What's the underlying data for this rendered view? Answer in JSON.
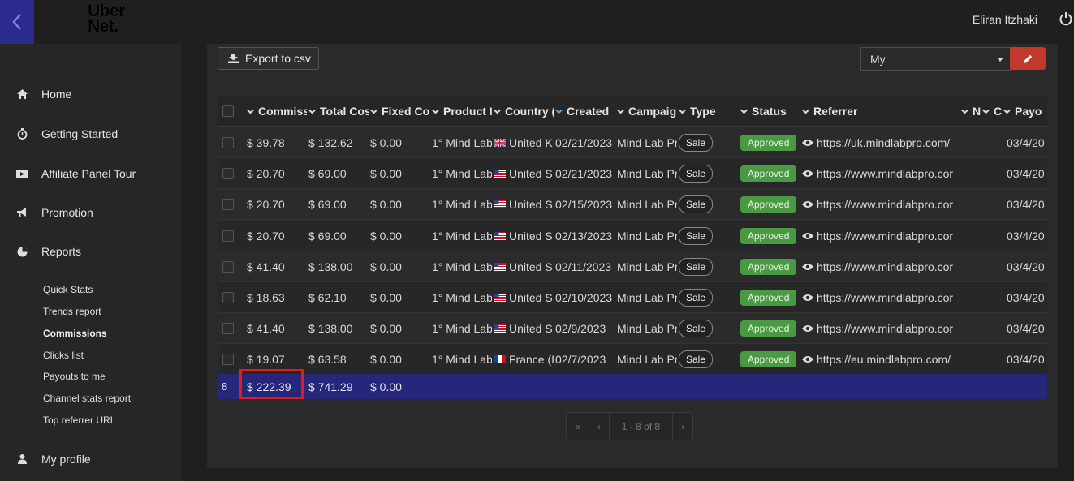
{
  "header": {
    "logo_line1": "Uber",
    "logo_line2": "Net.",
    "user_name": "Eliran Itzhaki"
  },
  "sidebar": {
    "items": [
      {
        "label": "Home",
        "icon": "home-icon"
      },
      {
        "label": "Getting Started",
        "icon": "stopwatch-icon"
      },
      {
        "label": "Affiliate Panel Tour",
        "icon": "video-icon"
      },
      {
        "label": "Promotion",
        "icon": "bullhorn-icon"
      },
      {
        "label": "Reports",
        "icon": "pie-chart-icon"
      },
      {
        "label": "My profile",
        "icon": "user-icon"
      }
    ],
    "report_subitems": [
      "Quick Stats",
      "Trends report",
      "Commissions",
      "Clicks list",
      "Payouts to me",
      "Channel stats report",
      "Top referrer URL"
    ],
    "active_subitem": "Commissions"
  },
  "toolbar": {
    "export_label": "Export to csv",
    "view_select_value": "My"
  },
  "table": {
    "columns": [
      "Commiss",
      "Total Cos",
      "Fixed Co",
      "Product I",
      "Country (",
      "Created",
      "Campaig",
      "Type",
      "Status",
      "Referrer",
      "N",
      "C",
      "Payo"
    ],
    "rows": [
      {
        "commission": "$ 39.78",
        "total_cost": "$ 132.62",
        "fixed_cost": "$ 0.00",
        "product": "1° Mind Lab",
        "country": "United K",
        "flag": "uk",
        "created": "02/21/2023",
        "campaign": "Mind Lab Pr",
        "type": "Sale",
        "status": "Approved",
        "referrer": "https://uk.mindlabpro.com/",
        "payout": "03/4/20"
      },
      {
        "commission": "$ 20.70",
        "total_cost": "$ 69.00",
        "fixed_cost": "$ 0.00",
        "product": "1° Mind Lab",
        "country": "United S",
        "flag": "us",
        "created": "02/21/2023",
        "campaign": "Mind Lab Pr",
        "type": "Sale",
        "status": "Approved",
        "referrer": "https://www.mindlabpro.cor",
        "payout": "03/4/20"
      },
      {
        "commission": "$ 20.70",
        "total_cost": "$ 69.00",
        "fixed_cost": "$ 0.00",
        "product": "1° Mind Lab",
        "country": "United S",
        "flag": "us",
        "created": "02/15/2023",
        "campaign": "Mind Lab Pr",
        "type": "Sale",
        "status": "Approved",
        "referrer": "https://www.mindlabpro.cor",
        "payout": "03/4/20"
      },
      {
        "commission": "$ 20.70",
        "total_cost": "$ 69.00",
        "fixed_cost": "$ 0.00",
        "product": "1° Mind Lab",
        "country": "United S",
        "flag": "us",
        "created": "02/13/2023",
        "campaign": "Mind Lab Pr",
        "type": "Sale",
        "status": "Approved",
        "referrer": "https://www.mindlabpro.cor",
        "payout": "03/4/20"
      },
      {
        "commission": "$ 41.40",
        "total_cost": "$ 138.00",
        "fixed_cost": "$ 0.00",
        "product": "1° Mind Lab",
        "country": "United S",
        "flag": "us",
        "created": "02/11/2023",
        "campaign": "Mind Lab Pr",
        "type": "Sale",
        "status": "Approved",
        "referrer": "https://www.mindlabpro.cor",
        "payout": "03/4/20"
      },
      {
        "commission": "$ 18.63",
        "total_cost": "$ 62.10",
        "fixed_cost": "$ 0.00",
        "product": "1° Mind Lab",
        "country": "United S",
        "flag": "us",
        "created": "02/10/2023",
        "campaign": "Mind Lab Pr",
        "type": "Sale",
        "status": "Approved",
        "referrer": "https://www.mindlabpro.cor",
        "payout": "03/4/20"
      },
      {
        "commission": "$ 41.40",
        "total_cost": "$ 138.00",
        "fixed_cost": "$ 0.00",
        "product": "1° Mind Lab",
        "country": "United S",
        "flag": "us",
        "created": "02/9/2023",
        "campaign": "Mind Lab Pr",
        "type": "Sale",
        "status": "Approved",
        "referrer": "https://www.mindlabpro.cor",
        "payout": "03/4/20"
      },
      {
        "commission": "$ 19.07",
        "total_cost": "$ 63.58",
        "fixed_cost": "$ 0.00",
        "product": "1° Mind Lab",
        "country": "France (I",
        "flag": "fr",
        "created": "02/7/2023",
        "campaign": "Mind Lab Pr",
        "type": "Sale",
        "status": "Approved",
        "referrer": "https://eu.mindlabpro.com/",
        "payout": "03/4/20"
      }
    ],
    "totals": {
      "count": "8",
      "commission": "$ 222.39",
      "total_cost": "$ 741.29",
      "fixed_cost": "$ 0.00"
    }
  },
  "pagination": {
    "first": "«",
    "prev": "‹",
    "info": "1 - 8 of 8",
    "next": "›"
  },
  "colors": {
    "accent": "#2b2b8e",
    "totals_row": "#26267a",
    "approved": "#4a9a44",
    "edit_button": "#c0392b",
    "highlight": "#e21c1c"
  }
}
